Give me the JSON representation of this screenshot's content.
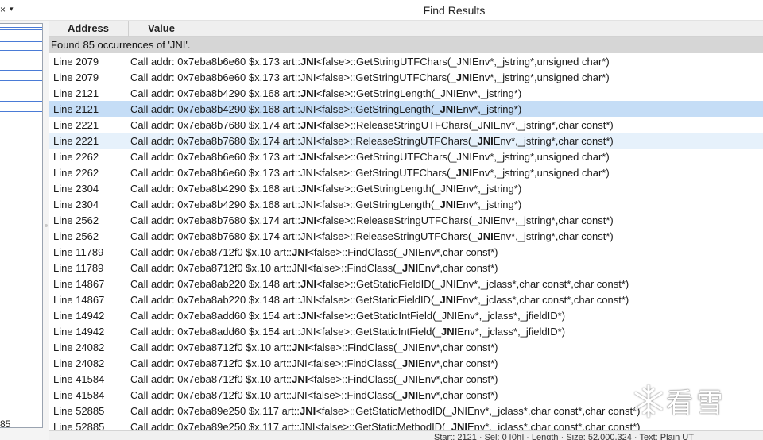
{
  "window": {
    "title": "Find Results",
    "close_glyph": "×",
    "menu_glyph": "▾"
  },
  "left_panel": {
    "number": "85"
  },
  "table": {
    "columns": [
      "Address",
      "Value"
    ],
    "found_text": "Found 85 occurrences of 'JNI'.",
    "rows": [
      {
        "addr": "Line 2079",
        "pre": "Call addr: 0x7eba8b6e60 $x.173 art::",
        "mid": "JNI",
        "mid_bold": true,
        "post1": "<false>::GetStringUTFChars(_",
        "jni2": "JNI",
        "jni2_bold": false,
        "post2": "Env*,_jstring*,unsigned char*)"
      },
      {
        "addr": "Line 2079",
        "pre": "Call addr: 0x7eba8b6e60 $x.173 art::",
        "mid": "JNI",
        "mid_bold": false,
        "post1": "<false>::GetStringUTFChars(_",
        "jni2": "JNI",
        "jni2_bold": true,
        "post2": "Env*,_jstring*,unsigned char*)"
      },
      {
        "addr": "Line 2121",
        "pre": "Call addr: 0x7eba8b4290 $x.168 art::",
        "mid": "JNI",
        "mid_bold": true,
        "post1": "<false>::GetStringLength(_",
        "jni2": "JNI",
        "jni2_bold": false,
        "post2": "Env*,_jstring*)"
      },
      {
        "addr": "Line 2121",
        "pre": "Call addr: 0x7eba8b4290 $x.168 art::",
        "mid": "JNI",
        "mid_bold": false,
        "post1": "<false>::GetStringLength(_",
        "jni2": "JNI",
        "jni2_bold": true,
        "post2": "Env*,_jstring*)"
      },
      {
        "addr": "Line 2221",
        "pre": "Call addr: 0x7eba8b7680 $x.174 art::",
        "mid": "JNI",
        "mid_bold": true,
        "post1": "<false>::ReleaseStringUTFChars(_",
        "jni2": "JNI",
        "jni2_bold": false,
        "post2": "Env*,_jstring*,char const*)"
      },
      {
        "addr": "Line 2221",
        "pre": "Call addr: 0x7eba8b7680 $x.174 art::",
        "mid": "JNI",
        "mid_bold": false,
        "post1": "<false>::ReleaseStringUTFChars(_",
        "jni2": "JNI",
        "jni2_bold": true,
        "post2": "Env*,_jstring*,char const*)"
      },
      {
        "addr": "Line 2262",
        "pre": "Call addr: 0x7eba8b6e60 $x.173 art::",
        "mid": "JNI",
        "mid_bold": true,
        "post1": "<false>::GetStringUTFChars(_",
        "jni2": "JNI",
        "jni2_bold": false,
        "post2": "Env*,_jstring*,unsigned char*)"
      },
      {
        "addr": "Line 2262",
        "pre": "Call addr: 0x7eba8b6e60 $x.173 art::",
        "mid": "JNI",
        "mid_bold": false,
        "post1": "<false>::GetStringUTFChars(_",
        "jni2": "JNI",
        "jni2_bold": true,
        "post2": "Env*,_jstring*,unsigned char*)"
      },
      {
        "addr": "Line 2304",
        "pre": "Call addr: 0x7eba8b4290 $x.168 art::",
        "mid": "JNI",
        "mid_bold": true,
        "post1": "<false>::GetStringLength(_",
        "jni2": "JNI",
        "jni2_bold": false,
        "post2": "Env*,_jstring*)"
      },
      {
        "addr": "Line 2304",
        "pre": "Call addr: 0x7eba8b4290 $x.168 art::",
        "mid": "JNI",
        "mid_bold": false,
        "post1": "<false>::GetStringLength(_",
        "jni2": "JNI",
        "jni2_bold": true,
        "post2": "Env*,_jstring*)"
      },
      {
        "addr": "Line 2562",
        "pre": "Call addr: 0x7eba8b7680 $x.174 art::",
        "mid": "JNI",
        "mid_bold": true,
        "post1": "<false>::ReleaseStringUTFChars(_",
        "jni2": "JNI",
        "jni2_bold": false,
        "post2": "Env*,_jstring*,char const*)"
      },
      {
        "addr": "Line 2562",
        "pre": "Call addr: 0x7eba8b7680 $x.174 art::",
        "mid": "JNI",
        "mid_bold": false,
        "post1": "<false>::ReleaseStringUTFChars(_",
        "jni2": "JNI",
        "jni2_bold": true,
        "post2": "Env*,_jstring*,char const*)"
      },
      {
        "addr": "Line 11789",
        "pre": "Call addr: 0x7eba8712f0 $x.10 art::",
        "mid": "JNI",
        "mid_bold": true,
        "post1": "<false>::FindClass(_",
        "jni2": "JNI",
        "jni2_bold": false,
        "post2": "Env*,char const*)"
      },
      {
        "addr": "Line 11789",
        "pre": "Call addr: 0x7eba8712f0 $x.10 art::",
        "mid": "JNI",
        "mid_bold": false,
        "post1": "<false>::FindClass(_",
        "jni2": "JNI",
        "jni2_bold": true,
        "post2": "Env*,char const*)"
      },
      {
        "addr": "Line 14867",
        "pre": "Call addr: 0x7eba8ab220 $x.148 art::",
        "mid": "JNI",
        "mid_bold": true,
        "post1": "<false>::GetStaticFieldID(_",
        "jni2": "JNI",
        "jni2_bold": false,
        "post2": "Env*,_jclass*,char const*,char const*)"
      },
      {
        "addr": "Line 14867",
        "pre": "Call addr: 0x7eba8ab220 $x.148 art::",
        "mid": "JNI",
        "mid_bold": false,
        "post1": "<false>::GetStaticFieldID(_",
        "jni2": "JNI",
        "jni2_bold": true,
        "post2": "Env*,_jclass*,char const*,char const*)"
      },
      {
        "addr": "Line 14942",
        "pre": "Call addr: 0x7eba8add60 $x.154 art::",
        "mid": "JNI",
        "mid_bold": true,
        "post1": "<false>::GetStaticIntField(_",
        "jni2": "JNI",
        "jni2_bold": false,
        "post2": "Env*,_jclass*,_jfieldID*)"
      },
      {
        "addr": "Line 14942",
        "pre": "Call addr: 0x7eba8add60 $x.154 art::",
        "mid": "JNI",
        "mid_bold": false,
        "post1": "<false>::GetStaticIntField(_",
        "jni2": "JNI",
        "jni2_bold": true,
        "post2": "Env*,_jclass*,_jfieldID*)"
      },
      {
        "addr": "Line 24082",
        "pre": "Call addr: 0x7eba8712f0 $x.10 art::",
        "mid": "JNI",
        "mid_bold": true,
        "post1": "<false>::FindClass(_",
        "jni2": "JNI",
        "jni2_bold": false,
        "post2": "Env*,char const*)"
      },
      {
        "addr": "Line 24082",
        "pre": "Call addr: 0x7eba8712f0 $x.10 art::",
        "mid": "JNI",
        "mid_bold": false,
        "post1": "<false>::FindClass(_",
        "jni2": "JNI",
        "jni2_bold": true,
        "post2": "Env*,char const*)"
      },
      {
        "addr": "Line 41584",
        "pre": "Call addr: 0x7eba8712f0 $x.10 art::",
        "mid": "JNI",
        "mid_bold": true,
        "post1": "<false>::FindClass(_",
        "jni2": "JNI",
        "jni2_bold": false,
        "post2": "Env*,char const*)"
      },
      {
        "addr": "Line 41584",
        "pre": "Call addr: 0x7eba8712f0 $x.10 art::",
        "mid": "JNI",
        "mid_bold": false,
        "post1": "<false>::FindClass(_",
        "jni2": "JNI",
        "jni2_bold": true,
        "post2": "Env*,char const*)"
      },
      {
        "addr": "Line 52885",
        "pre": "Call addr: 0x7eba89e250 $x.117 art::",
        "mid": "JNI",
        "mid_bold": true,
        "post1": "<false>::GetStaticMethodID(_",
        "jni2": "JNI",
        "jni2_bold": false,
        "post2": "Env*,_jclass*,char const*,char const*)"
      },
      {
        "addr": "Line 52885",
        "pre": "Call addr: 0x7eba89e250 $x.117 art::",
        "mid": "JNI",
        "mid_bold": false,
        "post1": "<false>::GetStaticMethodID(_",
        "jni2": "JNI",
        "jni2_bold": true,
        "post2": "Env*,_jclass*,char const*,char const*)"
      }
    ],
    "selected_index": 3,
    "hover_index": 5
  },
  "status_bar": {
    "text": "Start: 2121 · Sel: 0 [0h] · Length · Size: 52,000,324 · Text: Plain UT"
  },
  "watermark": {
    "text": "看雪",
    "icon": "snowflake-icon"
  }
}
